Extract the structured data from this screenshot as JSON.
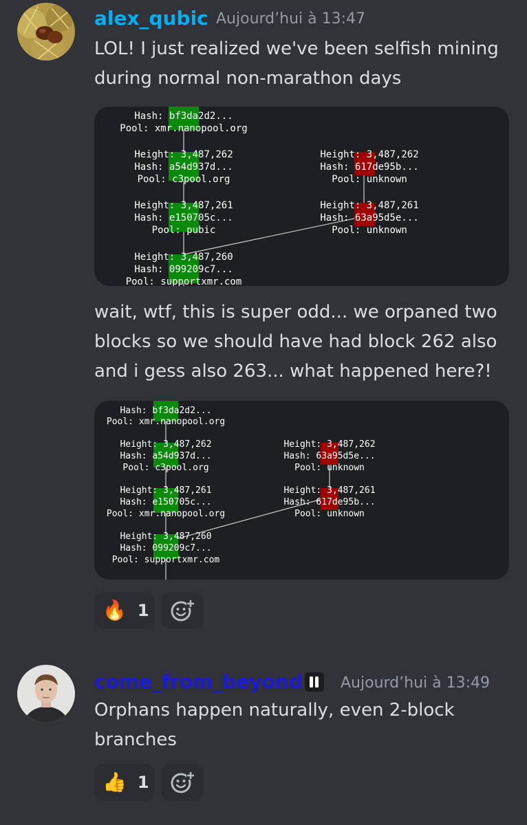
{
  "messages": [
    {
      "username": "alex_qubic",
      "username_color": "#00b0f4",
      "timestamp": "Aujourd’hui à 13:47",
      "text1": "LOL! I just realized we've been selfish mining during normal non-marathon days",
      "text2": "wait, wtf, this is super odd... we orpaned two blocks so we should have had block 262 also and i gess also 263... what happened here?!",
      "diagram1": {
        "b263_hash": "Hash: bf3da2d2...",
        "b263_pool": "Pool: xmr.nanopool.org",
        "l262_height": "Height: 3,487,262",
        "l262_hash": "Hash: a54d937d...",
        "l262_pool": "Pool: c3pool.org",
        "r262_height": "Height: 3,487,262",
        "r262_hash": "Hash: 617de95b...",
        "r262_pool": "Pool: unknown",
        "l261_height": "Height: 3,487,261",
        "l261_hash": "Hash: e150705c...",
        "l261_pool": "Pool: pubic",
        "r261_height": "Height: 3,487,261",
        "r261_hash": "Hash: 63a95d5e...",
        "r261_pool": "Pool: unknown",
        "b260_height": "Height: 3,487,260",
        "b260_hash": "Hash: 099209c7...",
        "b260_pool": "Pool: supportxmr.com"
      },
      "diagram2": {
        "b263_hash": "Hash: bf3da2d2...",
        "b263_pool": "Pool: xmr.nanopool.org",
        "l262_height": "Height: 3,487,262",
        "l262_hash": "Hash: a54d937d...",
        "l262_pool": "Pool: c3pool.org",
        "r262_height": "Height: 3,487,262",
        "r262_hash": "Hash: 63a95d5e...",
        "r262_pool": "Pool: unknown",
        "l261_height": "Height: 3,487,261",
        "l261_hash": "Hash: e150705c...",
        "l261_pool": "Pool: xmr.nanopool.org",
        "r261_height": "Height: 3,487,261",
        "r261_hash": "Hash: 617de95b...",
        "r261_pool": "Pool: unknown",
        "b260_height": "Height: 3,487,260",
        "b260_hash": "Hash: 099209c7...",
        "b260_pool": "Pool: supportxmr.com"
      },
      "reaction": {
        "emoji": "🔥",
        "emoji_name": "fire-icon",
        "count": "1"
      }
    },
    {
      "username": "come_from_beyond",
      "username_color": "#1b1bd6",
      "timestamp": "Aujourd’hui à 13:49",
      "text": "Orphans happen naturally, even 2-block branches",
      "reaction": {
        "emoji": "👍",
        "emoji_name": "thumbs-up-icon",
        "count": "1"
      }
    }
  ],
  "colors": {
    "background": "#313338",
    "embed_bg": "#1e1f22",
    "main_chain_block": "#0a8a0a",
    "orphan_block": "#a00000"
  }
}
